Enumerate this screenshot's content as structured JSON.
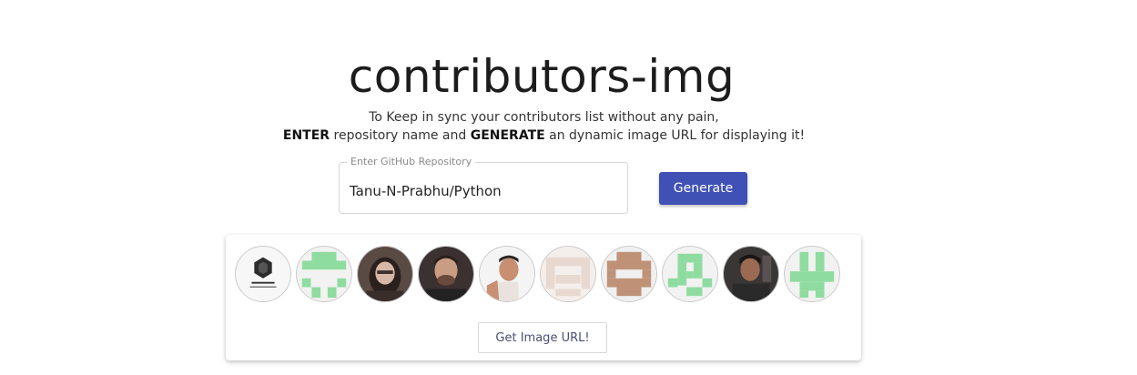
{
  "header": {
    "title": "contributors-img",
    "line1": "To Keep in sync your contributors list without any pain,",
    "enter_word": "ENTER",
    "middle_text": " repository name and ",
    "generate_word": "GENERATE",
    "end_text": " an dynamic image URL for displaying it!"
  },
  "form": {
    "legend": "Enter GitHub Repository",
    "value": "Tanu-N-Prabhu/Python",
    "generate_label": "Generate"
  },
  "contributors": {
    "count": 10,
    "url_button_label": "Get Image URL!"
  },
  "colors": {
    "accent": "#3f51b5",
    "identicon_green": "#8fdca0",
    "identicon_brown": "#bf9278",
    "identicon_beige": "#e8d9d0"
  }
}
